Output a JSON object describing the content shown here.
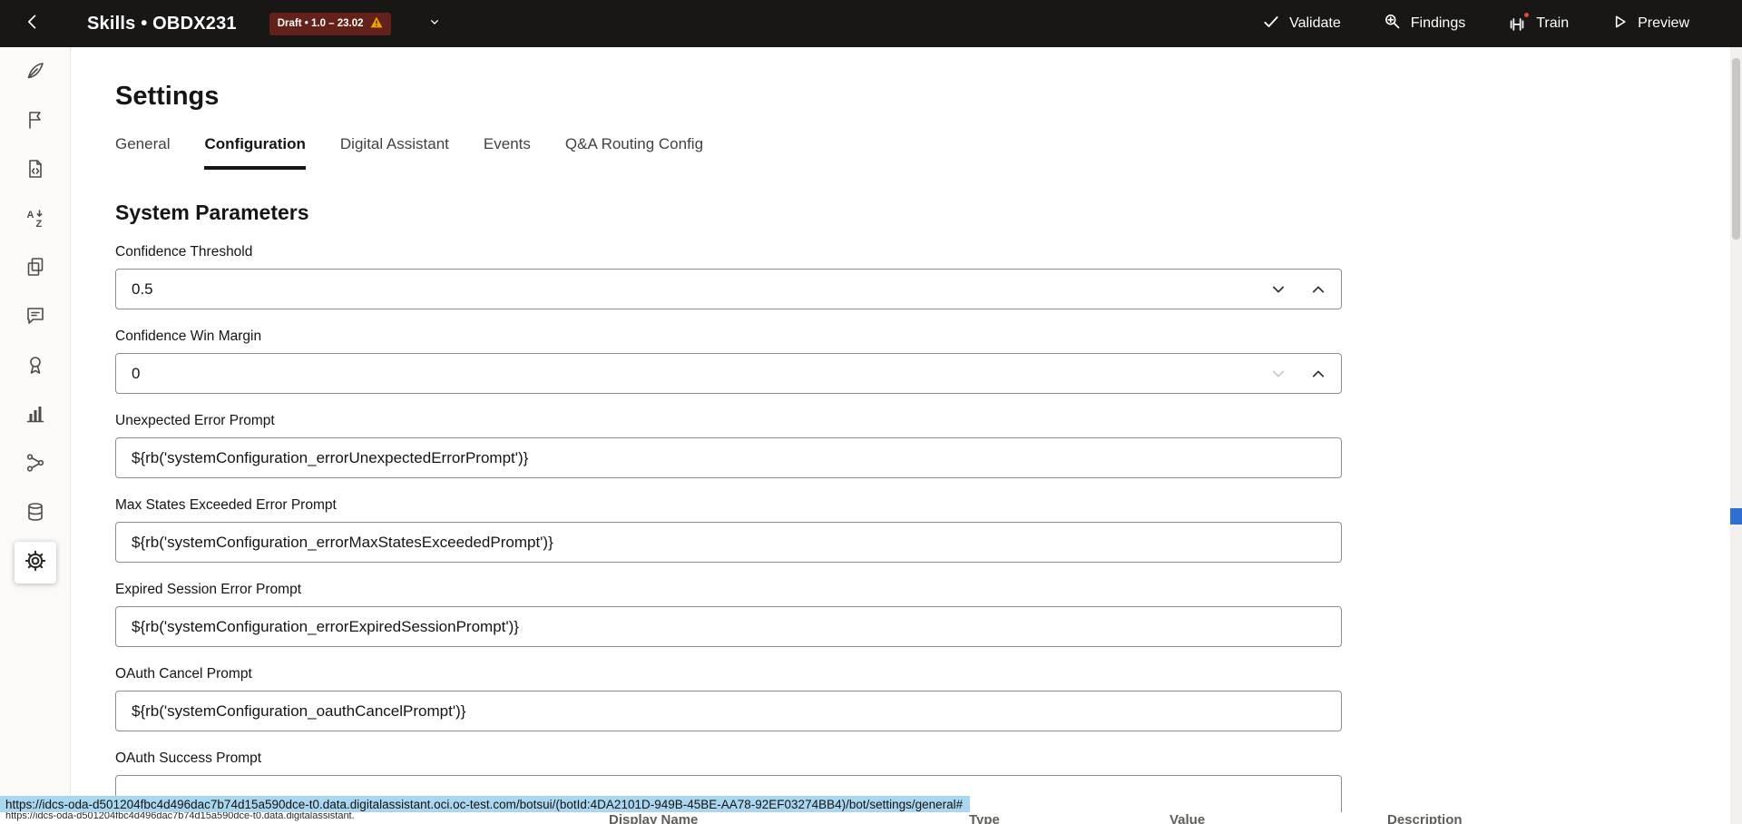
{
  "topbar": {
    "title": "Skills • OBDX231",
    "badge_label": "Draft • 1.0 – 23.02",
    "actions": [
      {
        "label": "Validate",
        "icon": "check-icon"
      },
      {
        "label": "Findings",
        "icon": "findings-icon"
      },
      {
        "label": "Train",
        "icon": "train-icon"
      },
      {
        "label": "Preview",
        "icon": "preview-icon"
      }
    ]
  },
  "sidebar": {
    "icons": [
      "quill-icon",
      "flag-icon",
      "file-code-icon",
      "translate-icon",
      "copy-icon",
      "chat-icon",
      "award-icon",
      "chart-icon",
      "share-icon",
      "database-icon",
      "gear-icon"
    ],
    "selected": "gear-icon"
  },
  "page": {
    "title": "Settings",
    "tabs": [
      "General",
      "Configuration",
      "Digital Assistant",
      "Events",
      "Q&A Routing Config"
    ],
    "active_tab": "Configuration",
    "section_title": "System Parameters",
    "fields": [
      {
        "label": "Confidence Threshold",
        "value": "0.5",
        "type": "stepper"
      },
      {
        "label": "Confidence Win Margin",
        "value": "0",
        "type": "stepper",
        "down_disabled": true
      },
      {
        "label": "Unexpected Error Prompt",
        "value": "${rb('systemConfiguration_errorUnexpectedErrorPrompt')}",
        "type": "text"
      },
      {
        "label": "Max States Exceeded Error Prompt",
        "value": "${rb('systemConfiguration_errorMaxStatesExceededPrompt')}",
        "type": "text"
      },
      {
        "label": "Expired Session Error Prompt",
        "value": "${rb('systemConfiguration_errorExpiredSessionPrompt')}",
        "type": "text"
      },
      {
        "label": "OAuth Cancel Prompt",
        "value": "${rb('systemConfiguration_oauthCancelPrompt')}",
        "type": "text"
      },
      {
        "label": "OAuth Success Prompt",
        "value": "",
        "type": "text"
      }
    ]
  },
  "statusbar": {
    "url": "https://idcs-oda-d501204fbc4d496dac7b74d15a590dce-t0.data.digitalassistant.oci.oc-test.com/botsui/(botId:4DA2101D-949B-45BE-AA78-92EF03274BB4)/bot/settings/general#"
  },
  "bottom_table": {
    "headers": [
      "Display Name",
      "Type",
      "Value",
      "Description"
    ]
  },
  "colors": {
    "topbar_bg": "#181716",
    "badge_bg": "#63211a",
    "warning_yellow": "#f0a300",
    "train_dot_red": "#e5462e",
    "active_underline": "#161513",
    "status_highlight": "#a9d7f2",
    "find_marker_blue": "#2e6fd0"
  }
}
